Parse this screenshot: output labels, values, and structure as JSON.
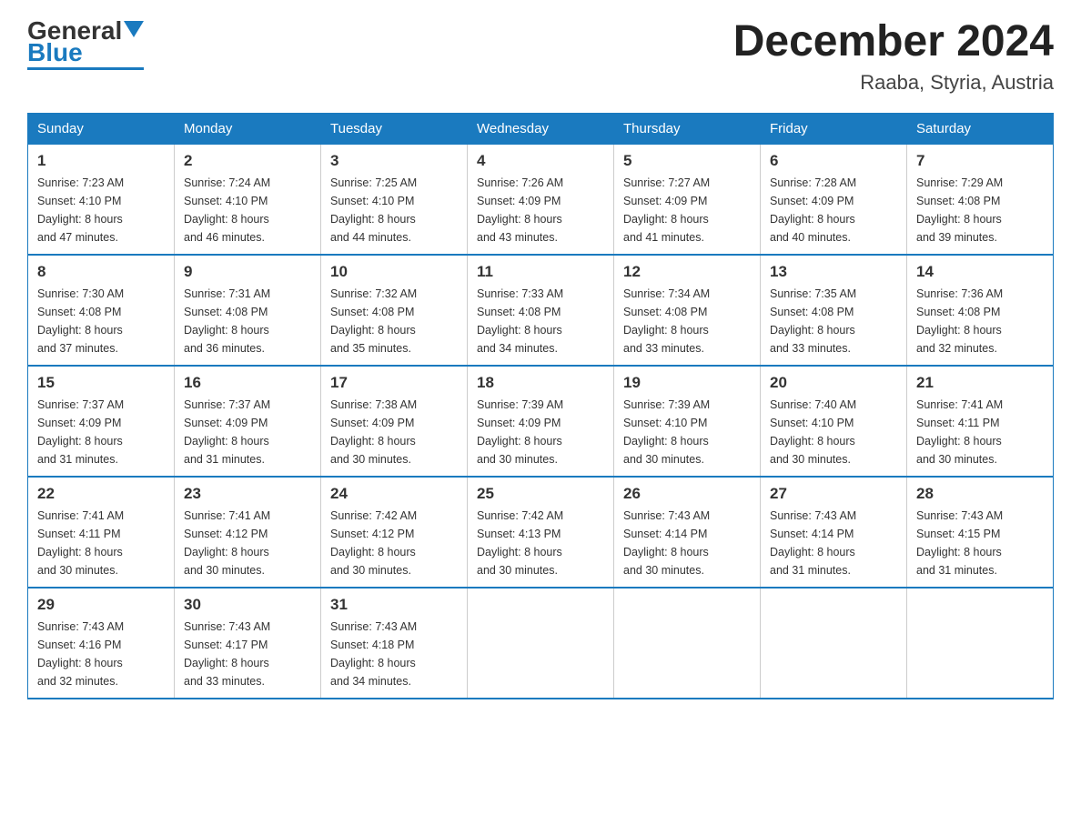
{
  "header": {
    "logo_general": "General",
    "logo_blue": "Blue",
    "month_title": "December 2024",
    "location": "Raaba, Styria, Austria"
  },
  "days_of_week": [
    "Sunday",
    "Monday",
    "Tuesday",
    "Wednesday",
    "Thursday",
    "Friday",
    "Saturday"
  ],
  "weeks": [
    [
      {
        "day": "1",
        "sunrise": "7:23 AM",
        "sunset": "4:10 PM",
        "daylight": "8 hours and 47 minutes."
      },
      {
        "day": "2",
        "sunrise": "7:24 AM",
        "sunset": "4:10 PM",
        "daylight": "8 hours and 46 minutes."
      },
      {
        "day": "3",
        "sunrise": "7:25 AM",
        "sunset": "4:10 PM",
        "daylight": "8 hours and 44 minutes."
      },
      {
        "day": "4",
        "sunrise": "7:26 AM",
        "sunset": "4:09 PM",
        "daylight": "8 hours and 43 minutes."
      },
      {
        "day": "5",
        "sunrise": "7:27 AM",
        "sunset": "4:09 PM",
        "daylight": "8 hours and 41 minutes."
      },
      {
        "day": "6",
        "sunrise": "7:28 AM",
        "sunset": "4:09 PM",
        "daylight": "8 hours and 40 minutes."
      },
      {
        "day": "7",
        "sunrise": "7:29 AM",
        "sunset": "4:08 PM",
        "daylight": "8 hours and 39 minutes."
      }
    ],
    [
      {
        "day": "8",
        "sunrise": "7:30 AM",
        "sunset": "4:08 PM",
        "daylight": "8 hours and 37 minutes."
      },
      {
        "day": "9",
        "sunrise": "7:31 AM",
        "sunset": "4:08 PM",
        "daylight": "8 hours and 36 minutes."
      },
      {
        "day": "10",
        "sunrise": "7:32 AM",
        "sunset": "4:08 PM",
        "daylight": "8 hours and 35 minutes."
      },
      {
        "day": "11",
        "sunrise": "7:33 AM",
        "sunset": "4:08 PM",
        "daylight": "8 hours and 34 minutes."
      },
      {
        "day": "12",
        "sunrise": "7:34 AM",
        "sunset": "4:08 PM",
        "daylight": "8 hours and 33 minutes."
      },
      {
        "day": "13",
        "sunrise": "7:35 AM",
        "sunset": "4:08 PM",
        "daylight": "8 hours and 33 minutes."
      },
      {
        "day": "14",
        "sunrise": "7:36 AM",
        "sunset": "4:08 PM",
        "daylight": "8 hours and 32 minutes."
      }
    ],
    [
      {
        "day": "15",
        "sunrise": "7:37 AM",
        "sunset": "4:09 PM",
        "daylight": "8 hours and 31 minutes."
      },
      {
        "day": "16",
        "sunrise": "7:37 AM",
        "sunset": "4:09 PM",
        "daylight": "8 hours and 31 minutes."
      },
      {
        "day": "17",
        "sunrise": "7:38 AM",
        "sunset": "4:09 PM",
        "daylight": "8 hours and 30 minutes."
      },
      {
        "day": "18",
        "sunrise": "7:39 AM",
        "sunset": "4:09 PM",
        "daylight": "8 hours and 30 minutes."
      },
      {
        "day": "19",
        "sunrise": "7:39 AM",
        "sunset": "4:10 PM",
        "daylight": "8 hours and 30 minutes."
      },
      {
        "day": "20",
        "sunrise": "7:40 AM",
        "sunset": "4:10 PM",
        "daylight": "8 hours and 30 minutes."
      },
      {
        "day": "21",
        "sunrise": "7:41 AM",
        "sunset": "4:11 PM",
        "daylight": "8 hours and 30 minutes."
      }
    ],
    [
      {
        "day": "22",
        "sunrise": "7:41 AM",
        "sunset": "4:11 PM",
        "daylight": "8 hours and 30 minutes."
      },
      {
        "day": "23",
        "sunrise": "7:41 AM",
        "sunset": "4:12 PM",
        "daylight": "8 hours and 30 minutes."
      },
      {
        "day": "24",
        "sunrise": "7:42 AM",
        "sunset": "4:12 PM",
        "daylight": "8 hours and 30 minutes."
      },
      {
        "day": "25",
        "sunrise": "7:42 AM",
        "sunset": "4:13 PM",
        "daylight": "8 hours and 30 minutes."
      },
      {
        "day": "26",
        "sunrise": "7:43 AM",
        "sunset": "4:14 PM",
        "daylight": "8 hours and 30 minutes."
      },
      {
        "day": "27",
        "sunrise": "7:43 AM",
        "sunset": "4:14 PM",
        "daylight": "8 hours and 31 minutes."
      },
      {
        "day": "28",
        "sunrise": "7:43 AM",
        "sunset": "4:15 PM",
        "daylight": "8 hours and 31 minutes."
      }
    ],
    [
      {
        "day": "29",
        "sunrise": "7:43 AM",
        "sunset": "4:16 PM",
        "daylight": "8 hours and 32 minutes."
      },
      {
        "day": "30",
        "sunrise": "7:43 AM",
        "sunset": "4:17 PM",
        "daylight": "8 hours and 33 minutes."
      },
      {
        "day": "31",
        "sunrise": "7:43 AM",
        "sunset": "4:18 PM",
        "daylight": "8 hours and 34 minutes."
      },
      null,
      null,
      null,
      null
    ]
  ],
  "labels": {
    "sunrise": "Sunrise:",
    "sunset": "Sunset:",
    "daylight": "Daylight:"
  }
}
